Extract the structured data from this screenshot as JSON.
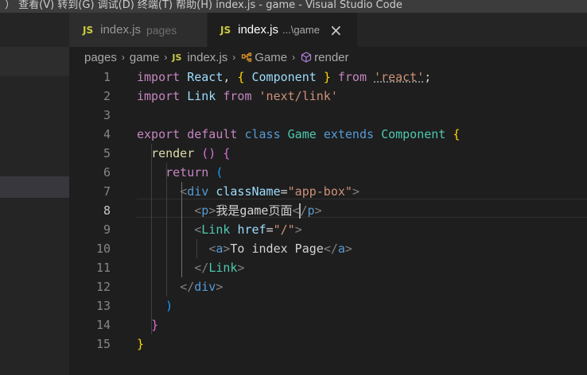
{
  "menubar": {
    "text": "）   查看(V)   转到(G)   调试(D)   终端(T)   帮助(H)   index.js - game - Visual Studio Code"
  },
  "tabs": [
    {
      "badge": "JS",
      "name": "index.js",
      "desc": "pages"
    },
    {
      "badge": "JS",
      "name": "index.js",
      "desc": "...\\game",
      "close": "×"
    }
  ],
  "breadcrumb": {
    "items": [
      "pages",
      "game",
      "index.js",
      "Game",
      "render"
    ],
    "separator": "›",
    "js_badge": "JS"
  },
  "editor": {
    "active_line": 8,
    "line_numbers": [
      "1",
      "2",
      "3",
      "4",
      "5",
      "6",
      "7",
      "8",
      "9",
      "10",
      "11",
      "12",
      "13",
      "14",
      "15"
    ],
    "lines": [
      [
        [
          "kw",
          "import"
        ],
        [
          "pn",
          " "
        ],
        [
          "vr",
          "React"
        ],
        [
          "pn",
          ", "
        ],
        [
          "br1",
          "{"
        ],
        [
          "pn",
          " "
        ],
        [
          "vr",
          "Component"
        ],
        [
          "pn",
          " "
        ],
        [
          "br1",
          "}"
        ],
        [
          "pn",
          " "
        ],
        [
          "kw",
          "from"
        ],
        [
          "pn",
          " "
        ],
        [
          "st",
          "'react'"
        ],
        [
          "pn",
          ";"
        ]
      ],
      [
        [
          "kw",
          "import"
        ],
        [
          "pn",
          " "
        ],
        [
          "vr",
          "Link"
        ],
        [
          "pn",
          " "
        ],
        [
          "kw",
          "from"
        ],
        [
          "pn",
          " "
        ],
        [
          "st",
          "'next/link'"
        ]
      ],
      [],
      [
        [
          "kw",
          "export"
        ],
        [
          "pn",
          " "
        ],
        [
          "kw",
          "default"
        ],
        [
          "pn",
          " "
        ],
        [
          "kb",
          "class"
        ],
        [
          "pn",
          " "
        ],
        [
          "cl",
          "Game"
        ],
        [
          "pn",
          " "
        ],
        [
          "kb",
          "extends"
        ],
        [
          "pn",
          " "
        ],
        [
          "cl",
          "Component"
        ],
        [
          "pn",
          " "
        ],
        [
          "br1",
          "{"
        ]
      ],
      [
        [
          "pn",
          "  "
        ],
        [
          "fn",
          "render"
        ],
        [
          "pn",
          " "
        ],
        [
          "br2",
          "()"
        ],
        [
          "pn",
          " "
        ],
        [
          "br2",
          "{"
        ]
      ],
      [
        [
          "pn",
          "    "
        ],
        [
          "kw",
          "return"
        ],
        [
          "pn",
          " "
        ],
        [
          "br3",
          "("
        ]
      ],
      [
        [
          "pn",
          "      "
        ],
        [
          "tg",
          "<"
        ],
        [
          "tn",
          "div"
        ],
        [
          "pn",
          " "
        ],
        [
          "at",
          "className"
        ],
        [
          "pn",
          "="
        ],
        [
          "st",
          "\"app-box\""
        ],
        [
          "tg",
          ">"
        ]
      ],
      [
        [
          "pn",
          "        "
        ],
        [
          "tg",
          "<"
        ],
        [
          "tn",
          "p"
        ],
        [
          "tg",
          ">"
        ],
        [
          "tx",
          "我是game页面"
        ],
        [
          "tg",
          "<"
        ],
        [
          "cur",
          ""
        ],
        [
          "tg",
          "/"
        ],
        [
          "tn",
          "p"
        ],
        [
          "tg",
          ">"
        ]
      ],
      [
        [
          "pn",
          "        "
        ],
        [
          "tg",
          "<"
        ],
        [
          "cl",
          "Link"
        ],
        [
          "pn",
          " "
        ],
        [
          "at",
          "href"
        ],
        [
          "pn",
          "="
        ],
        [
          "st",
          "\"/\""
        ],
        [
          "tg",
          ">"
        ]
      ],
      [
        [
          "pn",
          "          "
        ],
        [
          "tg",
          "<"
        ],
        [
          "tn",
          "a"
        ],
        [
          "tg",
          ">"
        ],
        [
          "tx",
          "To index Page"
        ],
        [
          "tg",
          "</"
        ],
        [
          "tn",
          "a"
        ],
        [
          "tg",
          ">"
        ]
      ],
      [
        [
          "pn",
          "        "
        ],
        [
          "tg",
          "</"
        ],
        [
          "cl",
          "Link"
        ],
        [
          "tg",
          ">"
        ]
      ],
      [
        [
          "pn",
          "      "
        ],
        [
          "tg",
          "</"
        ],
        [
          "tn",
          "div"
        ],
        [
          "tg",
          ">"
        ]
      ],
      [
        [
          "pn",
          "    "
        ],
        [
          "br3",
          ")"
        ]
      ],
      [
        [
          "pn",
          "  "
        ],
        [
          "br2",
          "}"
        ]
      ],
      [
        [
          "br1",
          "}"
        ]
      ]
    ]
  }
}
